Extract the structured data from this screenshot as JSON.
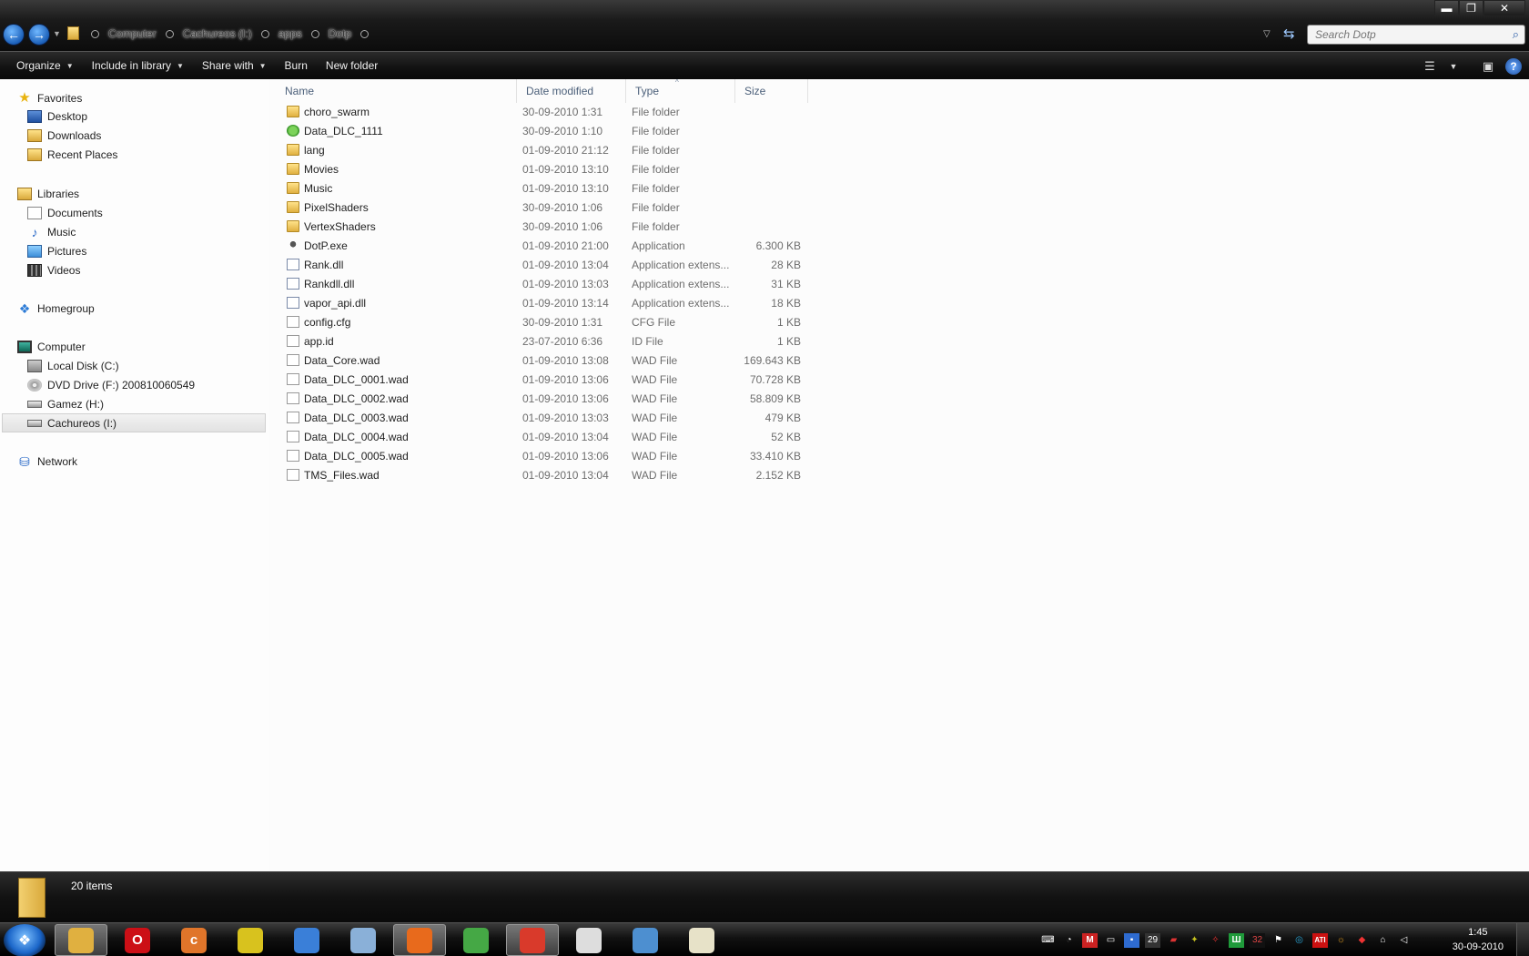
{
  "window": {
    "controls": {
      "minimize": "▬",
      "maximize": "❐",
      "close": "✕"
    }
  },
  "address": {
    "breadcrumbs": [
      "Computer",
      "Cachureos (I:)",
      "apps",
      "Dotp"
    ],
    "search_placeholder": "Search Dotp"
  },
  "toolbar": {
    "organize": "Organize",
    "include_in_library": "Include in library",
    "share_with": "Share with",
    "burn": "Burn",
    "new_folder": "New folder"
  },
  "nav": {
    "favorites": "Favorites",
    "desktop": "Desktop",
    "downloads": "Downloads",
    "recent_places": "Recent Places",
    "libraries": "Libraries",
    "documents": "Documents",
    "music": "Music",
    "pictures": "Pictures",
    "videos": "Videos",
    "homegroup": "Homegroup",
    "computer": "Computer",
    "local_disk": "Local Disk (C:)",
    "dvd_drive": "DVD Drive (F:) 200810060549",
    "gamez": "Gamez (H:)",
    "cachureos": "Cachureos (I:)",
    "network": "Network"
  },
  "columns": {
    "name": "Name",
    "date": "Date modified",
    "type": "Type",
    "size": "Size"
  },
  "files": [
    {
      "name": "choro_swarm",
      "date": "30-09-2010 1:31",
      "type": "File folder",
      "size": "",
      "icon": "folder"
    },
    {
      "name": "Data_DLC_1111",
      "date": "30-09-2010 1:10",
      "type": "File folder",
      "size": "",
      "icon": "folder-green"
    },
    {
      "name": "lang",
      "date": "01-09-2010 21:12",
      "type": "File folder",
      "size": "",
      "icon": "folder"
    },
    {
      "name": "Movies",
      "date": "01-09-2010 13:10",
      "type": "File folder",
      "size": "",
      "icon": "folder"
    },
    {
      "name": "Music",
      "date": "01-09-2010 13:10",
      "type": "File folder",
      "size": "",
      "icon": "folder"
    },
    {
      "name": "PixelShaders",
      "date": "30-09-2010 1:06",
      "type": "File folder",
      "size": "",
      "icon": "folder"
    },
    {
      "name": "VertexShaders",
      "date": "30-09-2010 1:06",
      "type": "File folder",
      "size": "",
      "icon": "folder"
    },
    {
      "name": "DotP.exe",
      "date": "01-09-2010 21:00",
      "type": "Application",
      "size": "6.300 KB",
      "icon": "exe"
    },
    {
      "name": "Rank.dll",
      "date": "01-09-2010 13:04",
      "type": "Application extens...",
      "size": "28 KB",
      "icon": "dll"
    },
    {
      "name": "Rankdll.dll",
      "date": "01-09-2010 13:03",
      "type": "Application extens...",
      "size": "31 KB",
      "icon": "dll"
    },
    {
      "name": "vapor_api.dll",
      "date": "01-09-2010 13:14",
      "type": "Application extens...",
      "size": "18 KB",
      "icon": "dll"
    },
    {
      "name": "config.cfg",
      "date": "30-09-2010 1:31",
      "type": "CFG File",
      "size": "1 KB",
      "icon": "cfg"
    },
    {
      "name": "app.id",
      "date": "23-07-2010 6:36",
      "type": "ID File",
      "size": "1 KB",
      "icon": "file"
    },
    {
      "name": "Data_Core.wad",
      "date": "01-09-2010 13:08",
      "type": "WAD File",
      "size": "169.643 KB",
      "icon": "file"
    },
    {
      "name": "Data_DLC_0001.wad",
      "date": "01-09-2010 13:06",
      "type": "WAD File",
      "size": "70.728 KB",
      "icon": "file"
    },
    {
      "name": "Data_DLC_0002.wad",
      "date": "01-09-2010 13:06",
      "type": "WAD File",
      "size": "58.809 KB",
      "icon": "file"
    },
    {
      "name": "Data_DLC_0003.wad",
      "date": "01-09-2010 13:03",
      "type": "WAD File",
      "size": "479 KB",
      "icon": "file"
    },
    {
      "name": "Data_DLC_0004.wad",
      "date": "01-09-2010 13:04",
      "type": "WAD File",
      "size": "52 KB",
      "icon": "file"
    },
    {
      "name": "Data_DLC_0005.wad",
      "date": "01-09-2010 13:06",
      "type": "WAD File",
      "size": "33.410 KB",
      "icon": "file"
    },
    {
      "name": "TMS_Files.wad",
      "date": "01-09-2010 13:04",
      "type": "WAD File",
      "size": "2.152 KB",
      "icon": "file"
    }
  ],
  "status": {
    "items": "20 items"
  },
  "taskbar": {
    "apps": [
      {
        "name": "explorer",
        "glyph": "",
        "color": "#e0b040",
        "active": true
      },
      {
        "name": "opera",
        "glyph": "O",
        "color": "#cc0f16",
        "active": false
      },
      {
        "name": "app-orange",
        "glyph": "c",
        "color": "#e0752a",
        "active": false
      },
      {
        "name": "app-yellow",
        "glyph": "",
        "color": "#d8c21e",
        "active": false
      },
      {
        "name": "app-blue",
        "glyph": "",
        "color": "#3a7fd8",
        "active": false
      },
      {
        "name": "calculator",
        "glyph": "",
        "color": "#8ab0d8",
        "active": false
      },
      {
        "name": "firefox",
        "glyph": "",
        "color": "#e86a1c",
        "active": true
      },
      {
        "name": "messenger",
        "glyph": "",
        "color": "#45a845",
        "active": false
      },
      {
        "name": "chrome",
        "glyph": "",
        "color": "#d93a2b",
        "active": true
      },
      {
        "name": "alien-app",
        "glyph": "",
        "color": "#dddddd",
        "active": false
      },
      {
        "name": "paint",
        "glyph": "",
        "color": "#4d8fd0",
        "active": false
      },
      {
        "name": "notepad",
        "glyph": "",
        "color": "#e7e2c8",
        "active": false
      }
    ],
    "tray_badge": "29",
    "tray_badge2": "32",
    "ati": "ATI",
    "time": "1:45",
    "date": "30-09-2010"
  }
}
